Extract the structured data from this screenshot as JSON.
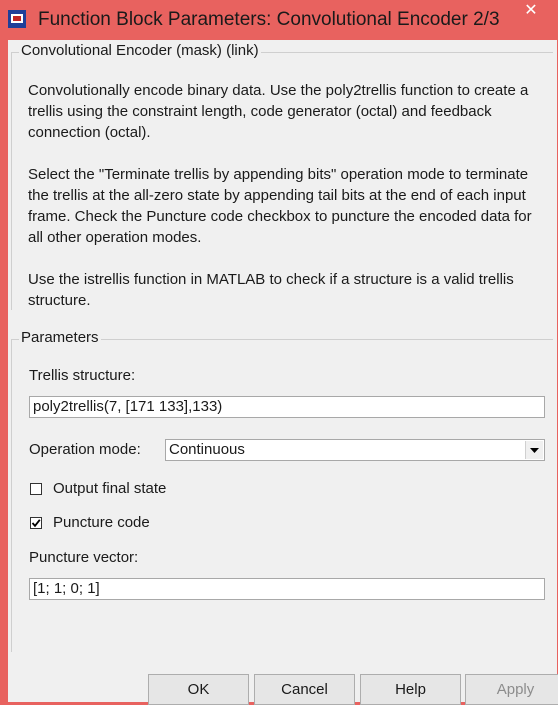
{
  "window": {
    "title": "Function Block Parameters: Convolutional Encoder 2/3",
    "close_label": "✕",
    "accent_color": "#e8625f"
  },
  "mask_group": {
    "legend": "Convolutional Encoder (mask) (link)",
    "paragraphs": [
      "Convolutionally encode binary data.  Use the poly2trellis function to create a trellis using the constraint length, code generator (octal) and feedback connection (octal).",
      "Select the \"Terminate trellis by appending bits\" operation mode to terminate the trellis at the all-zero state by appending tail bits at the end of each input frame.  Check the Puncture code checkbox to puncture the encoded data for all other operation modes.",
      "Use the istrellis function in MATLAB to check if a structure is a valid trellis structure."
    ]
  },
  "parameters": {
    "legend": "Parameters",
    "trellis_label": "Trellis structure:",
    "trellis_value": "poly2trellis(7, [171 133],133)",
    "operation_mode_label": "Operation mode:",
    "operation_mode_value": "Continuous",
    "output_final_state_label": "Output final state",
    "output_final_state_checked": false,
    "puncture_code_label": "Puncture code",
    "puncture_code_checked": true,
    "puncture_vector_label": "Puncture vector:",
    "puncture_vector_value": "[1; 1; 0; 1]"
  },
  "buttons": {
    "ok": "OK",
    "cancel": "Cancel",
    "help": "Help",
    "apply": "Apply"
  }
}
